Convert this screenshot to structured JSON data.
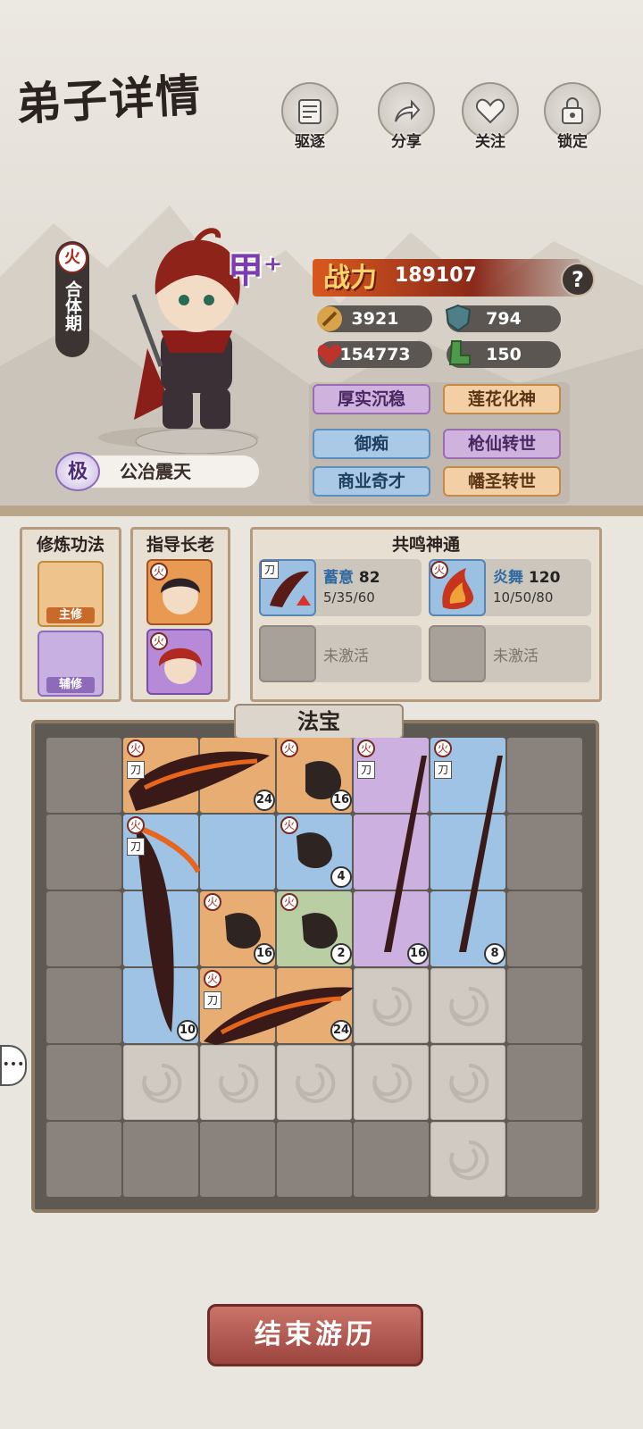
{
  "title": "弟子详情",
  "toolbar": [
    {
      "label": "驱逐",
      "icon": "scroll-icon"
    },
    {
      "label": "分享",
      "icon": "share-icon"
    },
    {
      "label": "关注",
      "icon": "heart-icon"
    },
    {
      "label": "锁定",
      "icon": "lock-icon"
    }
  ],
  "disciple": {
    "element": "火",
    "realm": "合体期",
    "grade": "甲⁺",
    "rank_badge": "极",
    "name": "公冶震天",
    "power_label": "战力",
    "power": "189107",
    "help": "?",
    "stats": {
      "attack": "3921",
      "defense": "794",
      "hp": "154773",
      "speed": "150"
    },
    "traits": [
      {
        "label": "厚实沉稳",
        "color": "purple"
      },
      {
        "label": "莲花化神",
        "color": "orange"
      },
      {
        "label": "御痴",
        "color": "blue"
      },
      {
        "label": "枪仙转世",
        "color": "purple"
      },
      {
        "label": "商业奇才",
        "color": "blue"
      },
      {
        "label": "幡圣转世",
        "color": "orange"
      }
    ]
  },
  "panels": {
    "cultivation_title": "修炼功法",
    "main_label": "主修",
    "aux_label": "辅修",
    "mentor_title": "指导长老",
    "mentor_element": "火",
    "resonance_title": "共鸣神通",
    "resonance": [
      {
        "type": "刀",
        "name": "蓄意",
        "level": "82",
        "progress": "5/35/60"
      },
      {
        "type": "火",
        "name": "炎舞",
        "level": "120",
        "progress": "10/50/80"
      },
      {
        "name": "未激活"
      },
      {
        "name": "未激活"
      }
    ]
  },
  "treasure": {
    "title": "法宝",
    "element": "火",
    "blade": "刀",
    "counts": [
      "24",
      "16",
      "4",
      "16",
      "2",
      "16",
      "8",
      "10",
      "24"
    ]
  },
  "end_button": "结束游历",
  "chat_icon": "chat-bubble-icon"
}
